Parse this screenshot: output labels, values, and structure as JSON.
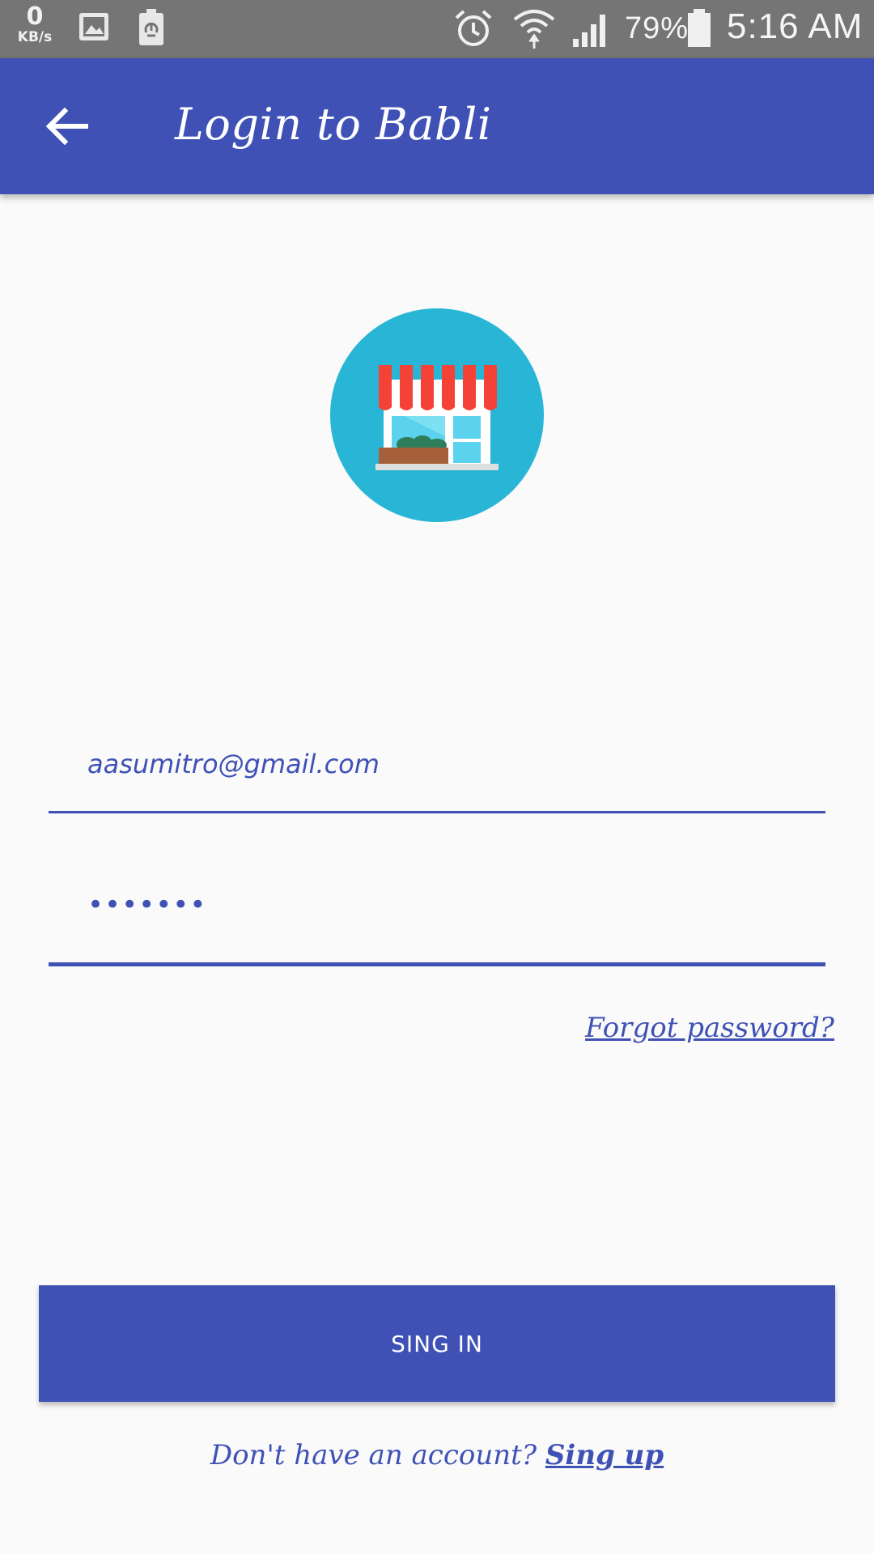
{
  "status_bar": {
    "network_speed_value": "0",
    "network_speed_unit": "KB/s",
    "battery_percent": "79%",
    "time": "5:16 AM",
    "icons": [
      "gallery-icon",
      "battery-saver-icon",
      "alarm-icon",
      "wifi-icon",
      "signal-icon",
      "battery-icon"
    ]
  },
  "app_bar": {
    "title": "Login to Babli",
    "back_icon": "arrow-back-icon",
    "color": "#3f51b5"
  },
  "logo": {
    "icon": "storefront-icon",
    "circle_color": "#29b6d6"
  },
  "form": {
    "email_value": "aasumitro@gmail.com",
    "password_value": "•••••••",
    "forgot_password_label": "Forgot password?",
    "signin_label": "SING IN",
    "signup_prompt": "Don't have an account?",
    "signup_link": "Sing up"
  },
  "colors": {
    "primary": "#3f51b5",
    "status_bar": "#757575",
    "background": "#fafafa"
  }
}
